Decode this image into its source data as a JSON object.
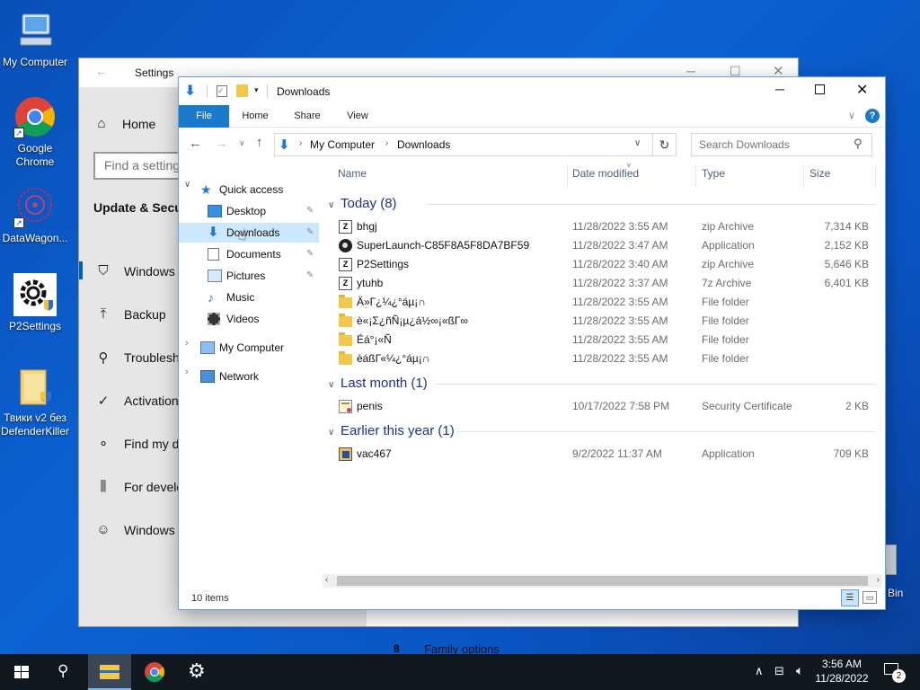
{
  "desktop": {
    "icons": [
      {
        "label": "My Computer"
      },
      {
        "label": "Google Chrome"
      },
      {
        "label": "DataWagon..."
      },
      {
        "label": "P2Settings"
      },
      {
        "label": "Твики v2 без DefenderKiller"
      },
      {
        "label": "Bin"
      }
    ]
  },
  "settings": {
    "title": "Settings",
    "home": "Home",
    "search_placeholder": "Find a setting",
    "section": "Update & Secu",
    "items": [
      "Windows S",
      "Backup",
      "Troublesho",
      "Activation",
      "Find my de",
      "For develo",
      "Windows I"
    ],
    "footer_link": "Family options"
  },
  "explorer": {
    "title": "Downloads",
    "tabs": [
      "File",
      "Home",
      "Share",
      "View"
    ],
    "breadcrumb": [
      "My Computer",
      "Downloads"
    ],
    "search_placeholder": "Search Downloads",
    "nav": {
      "quick_access": "Quick access",
      "desktop": "Desktop",
      "downloads": "Downloads",
      "documents": "Documents",
      "pictures": "Pictures",
      "music": "Music",
      "videos": "Videos",
      "my_computer": "My Computer",
      "network": "Network"
    },
    "columns": {
      "name": "Name",
      "date": "Date modified",
      "type": "Type",
      "size": "Size"
    },
    "groups": {
      "today": "Today (8)",
      "last_month": "Last month (1)",
      "earlier": "Earlier this year (1)"
    },
    "files": [
      {
        "name": "bhgj",
        "date": "11/28/2022 3:55 AM",
        "type": "zip Archive",
        "size": "7,314 KB",
        "icon": "zip-icon"
      },
      {
        "name": "SuperLaunch-C85F8A5F8DA7BF59",
        "date": "11/28/2022 3:47 AM",
        "type": "Application",
        "size": "2,152 KB",
        "icon": "app-icon"
      },
      {
        "name": "P2Settings",
        "date": "11/28/2022 3:40 AM",
        "type": "zip Archive",
        "size": "5,646 KB",
        "icon": "zip-icon"
      },
      {
        "name": "ytuhb",
        "date": "11/28/2022 3:37 AM",
        "type": "7z Archive",
        "size": "6,401 KB",
        "icon": "zip-icon"
      },
      {
        "name": "Ä»Г¿¼¿°áµ¡∩",
        "date": "11/28/2022 3:55 AM",
        "type": "File folder",
        "size": "",
        "icon": "folder-icon"
      },
      {
        "name": "è«¡Σ¿ñÑ¡µ¿á½∞¡«ßГ∞",
        "date": "11/28/2022 3:55 AM",
        "type": "File folder",
        "size": "",
        "icon": "folder-icon"
      },
      {
        "name": "Éá°¡«Ñ",
        "date": "11/28/2022 3:55 AM",
        "type": "File folder",
        "size": "",
        "icon": "folder-icon"
      },
      {
        "name": "èáßГ«¼¿°áµ¡∩",
        "date": "11/28/2022 3:55 AM",
        "type": "File folder",
        "size": "",
        "icon": "folder-icon"
      },
      {
        "name": "penis",
        "date": "10/17/2022 7:58 PM",
        "type": "Security Certificate",
        "size": "2 KB",
        "icon": "certificate-icon"
      },
      {
        "name": "vac467",
        "date": "9/2/2022 11:37 AM",
        "type": "Application",
        "size": "709 KB",
        "icon": "app-icon"
      }
    ],
    "status": "10 items"
  },
  "taskbar": {
    "time": "3:56 AM",
    "date": "11/28/2022",
    "notifications": "2"
  }
}
